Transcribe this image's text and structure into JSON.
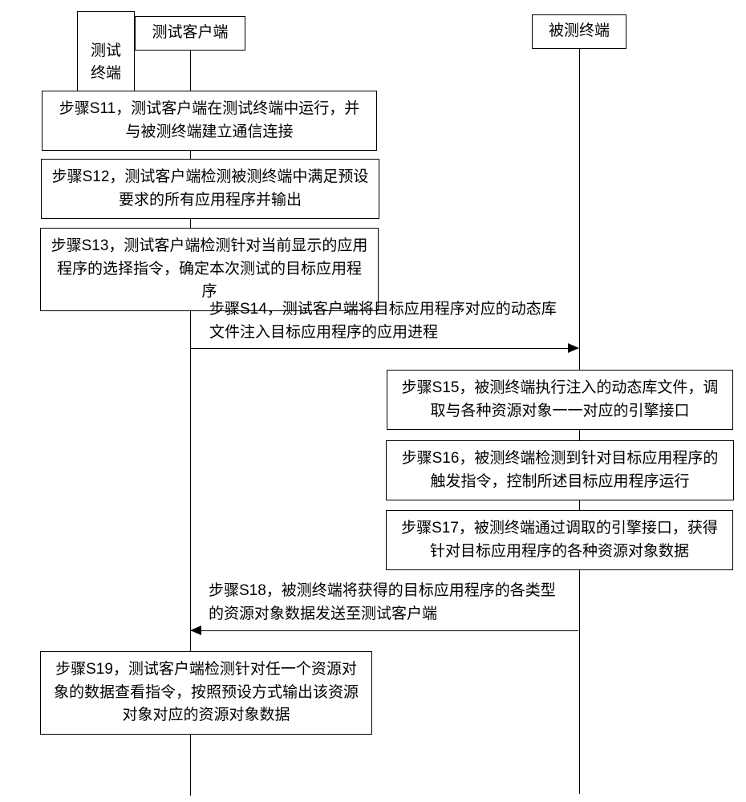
{
  "actors": {
    "test_terminal": "测试\n终端",
    "test_client": "测试客户端",
    "tested_terminal": "被测终端"
  },
  "steps": {
    "s11": "步骤S11，测试客户端在测试终端中运行，并与被测终端建立通信连接",
    "s12": "步骤S12，测试客户端检测被测终端中满足预设要求的所有应用程序并输出",
    "s13": "步骤S13，测试客户端检测针对当前显示的应用程序的选择指令，确定本次测试的目标应用程序",
    "s14": "步骤S14，测试客户端将目标应用程序对应的动态库文件注入目标应用程序的应用进程",
    "s15": "步骤S15，被测终端执行注入的动态库文件，调取与各种资源对象一一对应的引擎接口",
    "s16": "步骤S16，被测终端检测到针对目标应用程序的触发指令，控制所述目标应用程序运行",
    "s17": "步骤S17，被测终端通过调取的引擎接口，获得针对目标应用程序的各种资源对象数据",
    "s18": "步骤S18，被测终端将获得的目标应用程序的各类型的资源对象数据发送至测试客户端",
    "s19": "步骤S19，测试客户端检测针对任一个资源对象的数据查看指令，按照预设方式输出该资源对象对应的资源对象数据"
  }
}
